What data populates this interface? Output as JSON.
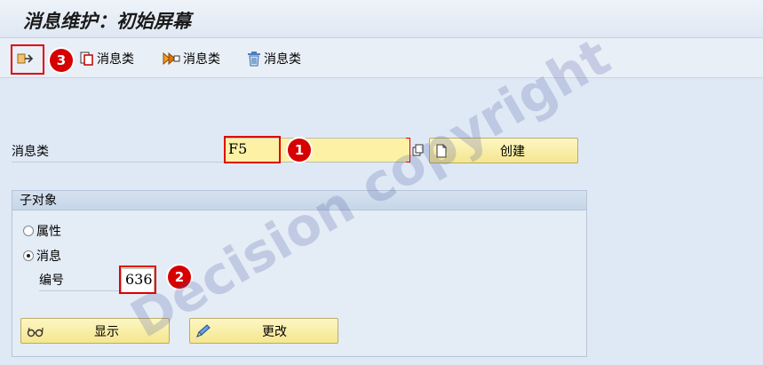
{
  "window": {
    "title": "消息维护：初始屏幕"
  },
  "toolbar": {
    "items": [
      {
        "icon": "display-switch-icon"
      },
      {
        "label": "消息类",
        "icon": "copy-icon"
      },
      {
        "label": "消息类",
        "icon": "rename-icon"
      },
      {
        "label": "消息类",
        "icon": "trash-icon"
      }
    ]
  },
  "form": {
    "message_class_label": "消息类",
    "message_class_value": "F5",
    "create_button": "创建"
  },
  "subobjects": {
    "title": "子对象",
    "attributes_label": "属性",
    "messages_label": "消息",
    "selected": "消息",
    "number_label": "编号",
    "number_value": "636",
    "display_button": "显示",
    "change_button": "更改"
  },
  "annotations": {
    "badge1": "1",
    "badge2": "2",
    "badge3": "3"
  },
  "watermark": "Decision copyright",
  "colors": {
    "input_bg": "#fdf1a6",
    "highlight": "#e00000",
    "badge": "#d60000"
  }
}
